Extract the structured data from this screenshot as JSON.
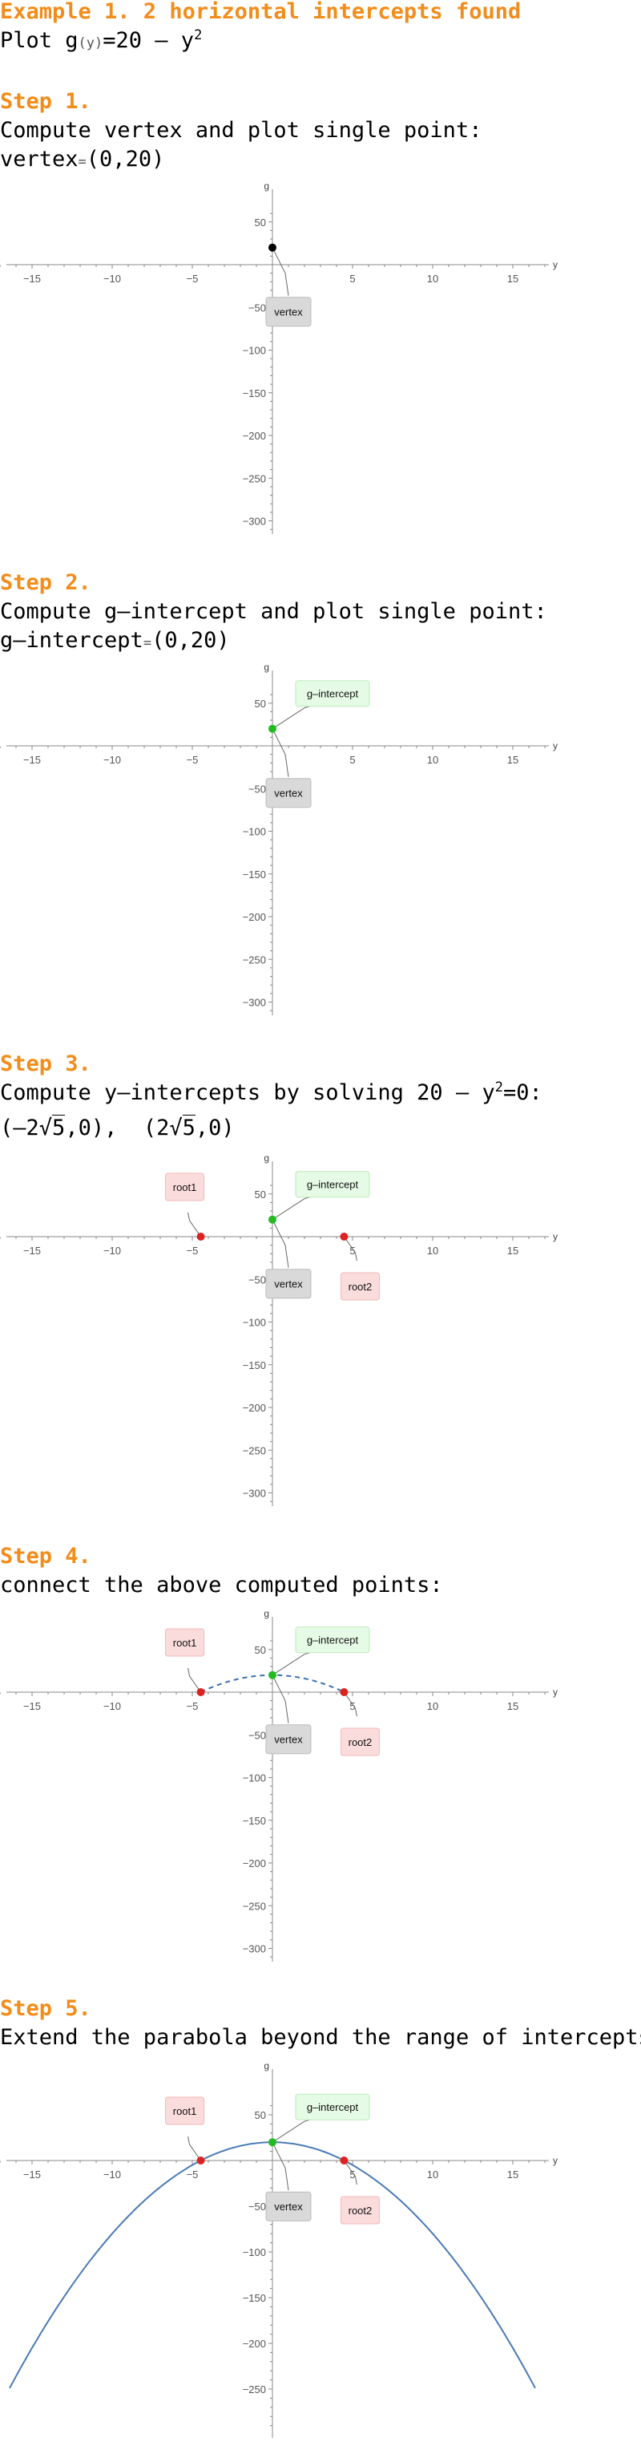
{
  "header": {
    "title": "Example 1. 2 horizontal intercepts found",
    "plot_prefix": "Plot g",
    "plot_arg": "(y)",
    "plot_eq": "=20 – y",
    "plot_exp": "2"
  },
  "steps": [
    {
      "heading": "Step 1.",
      "text": "Compute vertex and plot single point:",
      "result_name": "vertex",
      "result_value": "(0,20)"
    },
    {
      "heading": "Step 2.",
      "text": "Compute g–intercept and plot single point:",
      "result_name": "g–intercept",
      "result_value": "(0,20)"
    },
    {
      "heading": "Step 3.",
      "text_a": "Compute y–intercepts by solving 20 – y",
      "text_exp": "2",
      "text_b": "=0:",
      "root1_a": "(–2",
      "root1_rad": "5",
      "root1_b": ",0),",
      "root2_a": "(2",
      "root2_rad": "5",
      "root2_b": ",0)"
    },
    {
      "heading": "Step 4.",
      "text": "connect the above computed points:"
    },
    {
      "heading": "Step 5.",
      "text": "Extend the parabola beyond the range of intercepts"
    }
  ],
  "eq_sign": "=",
  "chart_data": [
    {
      "type": "scatter",
      "xlabel": "y",
      "ylabel": "g",
      "xlim": [
        -17,
        17
      ],
      "ylim": [
        -310,
        60
      ],
      "xticks": [
        "-15",
        "-10",
        "-5",
        "5",
        "10",
        "15"
      ],
      "yticks": [
        "50",
        "-50",
        "-100",
        "-150",
        "-200",
        "-250",
        "-300"
      ],
      "points": [
        {
          "x": 0,
          "y": 20,
          "label": "vertex",
          "color": "#000000"
        }
      ]
    },
    {
      "type": "scatter",
      "xlabel": "y",
      "ylabel": "g",
      "xlim": [
        -17,
        17
      ],
      "ylim": [
        -310,
        60
      ],
      "xticks": [
        "-15",
        "-10",
        "-5",
        "5",
        "10",
        "15"
      ],
      "yticks": [
        "50",
        "-50",
        "-100",
        "-150",
        "-200",
        "-250",
        "-300"
      ],
      "points": [
        {
          "x": 0,
          "y": 20,
          "label": "vertex"
        },
        {
          "x": 0,
          "y": 20,
          "label": "g–intercept",
          "color": "#22bb22"
        }
      ]
    },
    {
      "type": "scatter",
      "xlabel": "y",
      "ylabel": "g",
      "xlim": [
        -17,
        17
      ],
      "ylim": [
        -310,
        60
      ],
      "xticks": [
        "-15",
        "-10",
        "-5",
        "5",
        "10",
        "15"
      ],
      "yticks": [
        "50",
        "-50",
        "-100",
        "-150",
        "-200",
        "-250",
        "-300"
      ],
      "points": [
        {
          "x": 0,
          "y": 20,
          "label": "vertex"
        },
        {
          "x": 0,
          "y": 20,
          "label": "g–intercept",
          "color": "#22bb22"
        },
        {
          "x": -4.472,
          "y": 0,
          "label": "root1",
          "color": "#dd2222"
        },
        {
          "x": 4.472,
          "y": 0,
          "label": "root2",
          "color": "#dd2222"
        }
      ]
    },
    {
      "type": "line",
      "xlabel": "y",
      "ylabel": "g",
      "xlim": [
        -17,
        17
      ],
      "ylim": [
        -310,
        60
      ],
      "xticks": [
        "-15",
        "-10",
        "-5",
        "5",
        "10",
        "15"
      ],
      "yticks": [
        "50",
        "-50",
        "-100",
        "-150",
        "-200",
        "-250",
        "-300"
      ],
      "curve": {
        "function": "20 - y^2",
        "domain": [
          -4.472,
          4.472
        ],
        "style": "dashed",
        "color": "#3a6fb0"
      },
      "points": [
        {
          "x": 0,
          "y": 20,
          "label": "vertex"
        },
        {
          "x": 0,
          "y": 20,
          "label": "g–intercept",
          "color": "#22bb22"
        },
        {
          "x": -4.472,
          "y": 0,
          "label": "root1",
          "color": "#dd2222"
        },
        {
          "x": 4.472,
          "y": 0,
          "label": "root2",
          "color": "#dd2222"
        }
      ]
    },
    {
      "type": "line",
      "xlabel": "y",
      "ylabel": "g",
      "xlim": [
        -17,
        17
      ],
      "ylim": [
        -290,
        60
      ],
      "xticks": [
        "-15",
        "-10",
        "-5",
        "5",
        "10",
        "15"
      ],
      "yticks": [
        "50",
        "-50",
        "-100",
        "-150",
        "-200",
        "-250"
      ],
      "curve": {
        "function": "20 - y^2",
        "domain": [
          -16.4,
          16.4
        ],
        "style": "solid",
        "color": "#4a7ab5"
      },
      "points": [
        {
          "x": 0,
          "y": 20,
          "label": "vertex"
        },
        {
          "x": 0,
          "y": 20,
          "label": "g–intercept",
          "color": "#22bb22"
        },
        {
          "x": -4.472,
          "y": 0,
          "label": "root1",
          "color": "#dd2222"
        },
        {
          "x": 4.472,
          "y": 0,
          "label": "root2",
          "color": "#dd2222"
        }
      ]
    }
  ]
}
